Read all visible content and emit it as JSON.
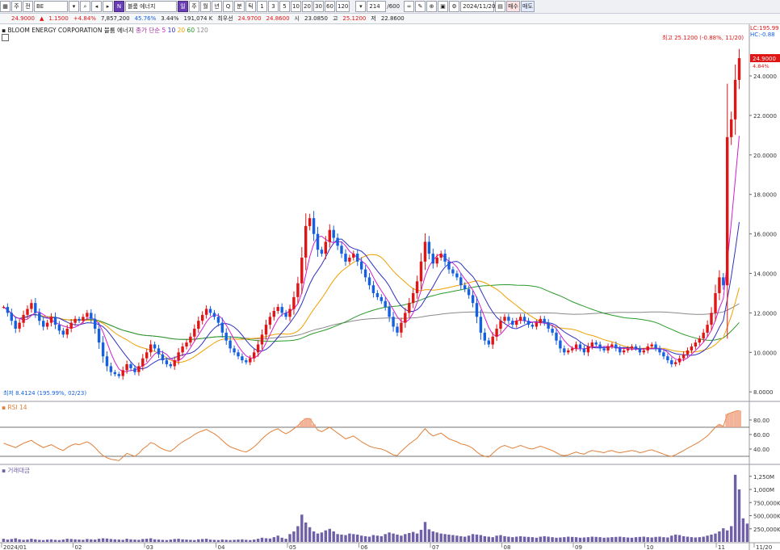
{
  "toolbar": {
    "items": [
      "주",
      "전",
      "BE",
      "신",
      "블룸 에너지",
      "일",
      "주",
      "월",
      "년",
      "Q",
      "분",
      "틱",
      "1",
      "3",
      "5",
      "10",
      "20",
      "30",
      "60",
      "120",
      "214",
      "/600",
      "2024/11/20",
      "매수",
      "매도"
    ],
    "symbol": "BE",
    "name": "블룸 에너지",
    "count": "214",
    "total": "/600",
    "date": "2024/11/20",
    "buy": "매수",
    "sell": "매도"
  },
  "quote": {
    "price": "24.9000",
    "change": "1.1500",
    "change_pct": "+4.84%",
    "volume": "7,857,200",
    "vol_pct": "45.76%",
    "turn": "3.44%",
    "amount": "191,074 K",
    "pre_label": "최우선",
    "bid": "24.9700",
    "ask": "24.8600",
    "open_label": "시",
    "open": "23.0850",
    "high_label": "고",
    "high": "25.1200",
    "low_label": "저",
    "low": "22.8600"
  },
  "legend": {
    "title": "BLOOM ENERGY CORPORATION",
    "name_kr": "블룸 에너지",
    "ma_label": "종가 단순",
    "ma5": "5",
    "ma10": "10",
    "ma20": "20",
    "ma60": "60",
    "ma120": "120"
  },
  "annotations": {
    "lc": "LC:195.99",
    "hc": "HC:-0.88",
    "high_note": "최고 25.1200 (-0.88%, 11/20)",
    "low_note": "최저 8.4124 (195.99%, 02/23)",
    "last_price": "24.9000",
    "last_pct": "4.84%"
  },
  "rsi": {
    "label": "RSI 14",
    "ticks": [
      "80.00",
      "60.00",
      "40.00"
    ]
  },
  "volume": {
    "label": "거래대금",
    "ticks": [
      "1,250M",
      "1,000M",
      "750,000K",
      "500,000K",
      "250,000K"
    ]
  },
  "colors": {
    "up": "#e01515",
    "down": "#1560e0",
    "ma5": "#d020d0",
    "ma10": "#3030c0",
    "ma20": "#f0a000",
    "ma60": "#2a9a2a",
    "ma120": "#8a8a8a",
    "rsi": "#e0803a",
    "vol": "#7060a8"
  },
  "chart_data": {
    "type": "candlestick",
    "x_tick_labels": [
      "2024/01",
      "02",
      "03",
      "04",
      "05",
      "06",
      "07",
      "08",
      "09",
      "10",
      "11",
      "11/20"
    ],
    "y_ticks": [
      8,
      10,
      12,
      14,
      16,
      18,
      20,
      22,
      24
    ],
    "y_tick_labels": [
      "8.0000",
      "10.0000",
      "12.0000",
      "14.0000",
      "16.0000",
      "18.0000",
      "20.0000",
      "22.0000",
      "24.0000"
    ],
    "ylim": [
      7.6,
      25.8
    ],
    "close": [
      12.3,
      12.0,
      11.6,
      11.2,
      11.5,
      11.9,
      12.2,
      12.5,
      12.0,
      11.6,
      11.3,
      11.5,
      11.8,
      11.4,
      11.1,
      10.9,
      11.2,
      11.5,
      11.7,
      11.6,
      11.8,
      12.0,
      11.7,
      11.2,
      10.5,
      9.8,
      9.3,
      9.0,
      8.9,
      8.8,
      9.1,
      9.4,
      9.2,
      9.0,
      9.3,
      9.7,
      10.0,
      10.4,
      10.2,
      9.9,
      9.6,
      9.4,
      9.3,
      9.6,
      10.0,
      10.3,
      10.5,
      10.8,
      11.2,
      11.6,
      11.9,
      12.2,
      12.0,
      11.8,
      11.5,
      11.0,
      10.6,
      10.2,
      10.0,
      9.8,
      9.6,
      9.5,
      9.7,
      10.0,
      10.4,
      10.9,
      11.4,
      11.8,
      12.1,
      12.3,
      12.0,
      11.8,
      12.2,
      12.8,
      13.5,
      14.8,
      16.4,
      16.8,
      16.0,
      15.2,
      15.0,
      15.6,
      16.2,
      15.8,
      15.4,
      15.0,
      14.6,
      14.8,
      15.0,
      14.6,
      14.2,
      13.8,
      13.4,
      13.0,
      12.8,
      12.6,
      12.3,
      11.8,
      11.3,
      11.0,
      11.5,
      12.0,
      12.5,
      13.0,
      13.6,
      14.6,
      15.6,
      15.0,
      14.5,
      14.8,
      15.0,
      14.6,
      14.2,
      14.0,
      13.8,
      13.4,
      13.2,
      12.9,
      12.5,
      11.8,
      11.0,
      10.6,
      10.4,
      10.8,
      11.2,
      11.6,
      11.8,
      11.6,
      11.4,
      11.6,
      11.8,
      11.6,
      11.4,
      11.3,
      11.5,
      11.7,
      11.5,
      11.2,
      11.0,
      10.6,
      10.2,
      10.0,
      10.1,
      10.2,
      10.4,
      10.2,
      10.0,
      10.3,
      10.5,
      10.4,
      10.2,
      10.1,
      10.3,
      10.4,
      10.2,
      10.0,
      10.1,
      10.2,
      10.3,
      10.2,
      10.0,
      10.1,
      10.3,
      10.4,
      10.2,
      10.0,
      9.8,
      9.6,
      9.4,
      9.5,
      9.7,
      9.9,
      10.1,
      10.3,
      10.5,
      10.7,
      11.0,
      11.4,
      12.0,
      13.0,
      13.8,
      13.4,
      20.9,
      21.8,
      23.8,
      24.9
    ],
    "volume_m": [
      60,
      45,
      55,
      70,
      50,
      40,
      45,
      60,
      50,
      40,
      35,
      45,
      50,
      40,
      35,
      45,
      60,
      55,
      50,
      45,
      40,
      55,
      50,
      45,
      60,
      70,
      65,
      55,
      50,
      45,
      40,
      60,
      50,
      45,
      40,
      55,
      60,
      70,
      50,
      45,
      40,
      35,
      45,
      55,
      60,
      50,
      45,
      40,
      35,
      50,
      55,
      60,
      45,
      40,
      35,
      45,
      40,
      35,
      40,
      45,
      50,
      40,
      35,
      45,
      60,
      80,
      70,
      65,
      90,
      120,
      80,
      60,
      150,
      200,
      300,
      520,
      370,
      280,
      200,
      160,
      180,
      220,
      250,
      200,
      150,
      140,
      130,
      160,
      150,
      140,
      120,
      110,
      100,
      130,
      120,
      110,
      150,
      180,
      160,
      140,
      120,
      150,
      170,
      190,
      160,
      230,
      380,
      240,
      200,
      180,
      160,
      150,
      140,
      130,
      120,
      110,
      100,
      120,
      150,
      140,
      130,
      110,
      100,
      90,
      120,
      130,
      110,
      100,
      90,
      100,
      110,
      100,
      95,
      90,
      80,
      100,
      110,
      100,
      90,
      80,
      85,
      90,
      100,
      95,
      90,
      80,
      85,
      90,
      100,
      95,
      90,
      80,
      85,
      90,
      95,
      100,
      90,
      85,
      80,
      90,
      95,
      100,
      90,
      85,
      95,
      100,
      90,
      85,
      120,
      140,
      130,
      110,
      100,
      90,
      85,
      90,
      100,
      120,
      140,
      160,
      200,
      260,
      220,
      300,
      1280,
      1000,
      450,
      350
    ],
    "rsi_values": [
      48,
      46,
      44,
      42,
      45,
      48,
      50,
      52,
      48,
      45,
      42,
      44,
      46,
      43,
      40,
      38,
      42,
      45,
      47,
      46,
      48,
      50,
      47,
      42,
      36,
      31,
      28,
      26,
      25,
      24,
      29,
      34,
      32,
      30,
      34,
      40,
      44,
      49,
      47,
      43,
      40,
      38,
      37,
      41,
      46,
      50,
      53,
      56,
      60,
      63,
      65,
      67,
      64,
      61,
      57,
      52,
      47,
      43,
      41,
      39,
      37,
      36,
      39,
      43,
      48,
      54,
      59,
      63,
      66,
      68,
      64,
      61,
      64,
      68,
      72,
      78,
      82,
      82,
      74,
      66,
      64,
      67,
      70,
      66,
      62,
      58,
      54,
      56,
      58,
      54,
      50,
      47,
      44,
      42,
      41,
      40,
      38,
      35,
      32,
      31,
      37,
      42,
      47,
      51,
      55,
      62,
      68,
      62,
      58,
      60,
      62,
      58,
      54,
      52,
      50,
      47,
      46,
      44,
      41,
      36,
      32,
      30,
      29,
      34,
      39,
      43,
      45,
      43,
      41,
      43,
      45,
      43,
      41,
      40,
      42,
      44,
      42,
      40,
      38,
      35,
      32,
      31,
      32,
      34,
      36,
      34,
      33,
      36,
      38,
      37,
      36,
      35,
      37,
      38,
      36,
      35,
      36,
      37,
      38,
      37,
      35,
      36,
      38,
      39,
      37,
      35,
      33,
      31,
      30,
      32,
      35,
      38,
      41,
      44,
      47,
      50,
      54,
      58,
      64,
      70,
      74,
      71,
      88,
      90,
      92,
      93
    ],
    "ma_series": [
      "5",
      "10",
      "20",
      "60",
      "120"
    ],
    "rsi_ylim": [
      20,
      100
    ],
    "volume_max_m": 1400
  }
}
